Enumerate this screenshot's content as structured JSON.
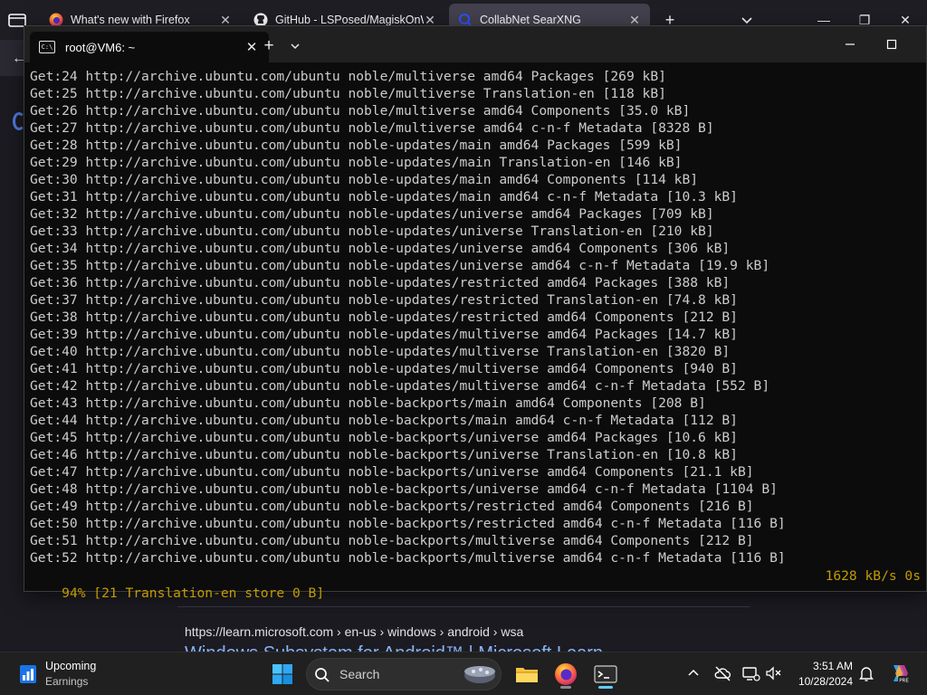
{
  "firefox": {
    "tabs": [
      {
        "title": "What's new with Firefox",
        "active": false,
        "icon": "firefox-icon"
      },
      {
        "title": "GitHub - LSPosed/MagiskOnW",
        "active": false,
        "icon": "github-icon"
      },
      {
        "title": "CollabNet SearXNG",
        "active": true,
        "icon": "searxng-icon"
      }
    ],
    "new_tab_label": "+",
    "window_controls": {
      "minimize": "—",
      "maximize": "❐",
      "close": "✕"
    },
    "back_label": "←",
    "result": {
      "breadcrumb": "https://learn.microsoft.com › en-us › windows › android › wsa",
      "title": "Windows Subsystem for Android™ | Microsoft Learn"
    }
  },
  "terminal": {
    "tab_title": "root@VM6: ~",
    "tab_icon_label": "C:\\",
    "close_label": "✕",
    "new_tab_label": "+",
    "lines": [
      "Get:24 http://archive.ubuntu.com/ubuntu noble/multiverse amd64 Packages [269 kB]",
      "Get:25 http://archive.ubuntu.com/ubuntu noble/multiverse Translation-en [118 kB]",
      "Get:26 http://archive.ubuntu.com/ubuntu noble/multiverse amd64 Components [35.0 kB]",
      "Get:27 http://archive.ubuntu.com/ubuntu noble/multiverse amd64 c-n-f Metadata [8328 B]",
      "Get:28 http://archive.ubuntu.com/ubuntu noble-updates/main amd64 Packages [599 kB]",
      "Get:29 http://archive.ubuntu.com/ubuntu noble-updates/main Translation-en [146 kB]",
      "Get:30 http://archive.ubuntu.com/ubuntu noble-updates/main amd64 Components [114 kB]",
      "Get:31 http://archive.ubuntu.com/ubuntu noble-updates/main amd64 c-n-f Metadata [10.3 kB]",
      "Get:32 http://archive.ubuntu.com/ubuntu noble-updates/universe amd64 Packages [709 kB]",
      "Get:33 http://archive.ubuntu.com/ubuntu noble-updates/universe Translation-en [210 kB]",
      "Get:34 http://archive.ubuntu.com/ubuntu noble-updates/universe amd64 Components [306 kB]",
      "Get:35 http://archive.ubuntu.com/ubuntu noble-updates/universe amd64 c-n-f Metadata [19.9 kB]",
      "Get:36 http://archive.ubuntu.com/ubuntu noble-updates/restricted amd64 Packages [388 kB]",
      "Get:37 http://archive.ubuntu.com/ubuntu noble-updates/restricted Translation-en [74.8 kB]",
      "Get:38 http://archive.ubuntu.com/ubuntu noble-updates/restricted amd64 Components [212 B]",
      "Get:39 http://archive.ubuntu.com/ubuntu noble-updates/multiverse amd64 Packages [14.7 kB]",
      "Get:40 http://archive.ubuntu.com/ubuntu noble-updates/multiverse Translation-en [3820 B]",
      "Get:41 http://archive.ubuntu.com/ubuntu noble-updates/multiverse amd64 Components [940 B]",
      "Get:42 http://archive.ubuntu.com/ubuntu noble-updates/multiverse amd64 c-n-f Metadata [552 B]",
      "Get:43 http://archive.ubuntu.com/ubuntu noble-backports/main amd64 Components [208 B]",
      "Get:44 http://archive.ubuntu.com/ubuntu noble-backports/main amd64 c-n-f Metadata [112 B]",
      "Get:45 http://archive.ubuntu.com/ubuntu noble-backports/universe amd64 Packages [10.6 kB]",
      "Get:46 http://archive.ubuntu.com/ubuntu noble-backports/universe Translation-en [10.8 kB]",
      "Get:47 http://archive.ubuntu.com/ubuntu noble-backports/universe amd64 Components [21.1 kB]",
      "Get:48 http://archive.ubuntu.com/ubuntu noble-backports/universe amd64 c-n-f Metadata [1104 B]",
      "Get:49 http://archive.ubuntu.com/ubuntu noble-backports/restricted amd64 Components [216 B]",
      "Get:50 http://archive.ubuntu.com/ubuntu noble-backports/restricted amd64 c-n-f Metadata [116 B]",
      "Get:51 http://archive.ubuntu.com/ubuntu noble-backports/multiverse amd64 Components [212 B]",
      "Get:52 http://archive.ubuntu.com/ubuntu noble-backports/multiverse amd64 c-n-f Metadata [116 B]"
    ],
    "status_left": "94% [21 Translation-en store 0 B]",
    "status_right": "1628 kB/s 0s"
  },
  "taskbar": {
    "weather_title": "Upcoming",
    "weather_subtitle": "Earnings",
    "search_label": "Search",
    "apps": [
      "windows-start-icon",
      "search-icon",
      "file-explorer-icon",
      "firefox-icon",
      "terminal-icon"
    ],
    "time": "3:51 AM",
    "date": "10/28/2024",
    "colors": {
      "accent": "#60cdff",
      "status_yellow": "#c19c00",
      "terminal_bg": "#0c0c0c"
    }
  }
}
